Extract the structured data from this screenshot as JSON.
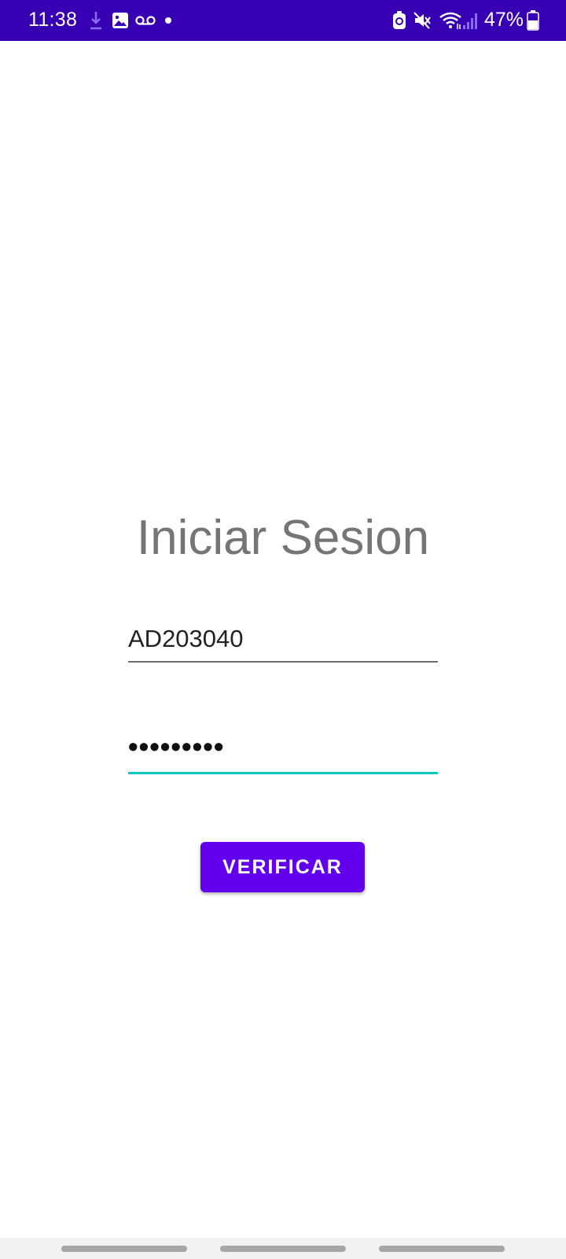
{
  "status_bar": {
    "time": "11:38",
    "battery": "47%",
    "background_color": "#3700b3",
    "icons_left": [
      "download-icon",
      "image-icon",
      "voicemail-icon",
      "notification-dot-icon"
    ],
    "icons_right": [
      "battery-saver-icon",
      "mute-icon",
      "wifi-icon",
      "signal-icon",
      "battery-icon"
    ]
  },
  "login": {
    "title": "Iniciar Sesion",
    "username_value": "AD203040",
    "password_value": "•••••••••",
    "verify_label": "VERIFICAR"
  },
  "colors": {
    "accent": "#6200ee",
    "focus_underline": "#03c8bd",
    "title_text": "#757575"
  },
  "nav_bar": {
    "items": [
      "recent-apps-pill",
      "home-pill",
      "back-pill"
    ]
  }
}
